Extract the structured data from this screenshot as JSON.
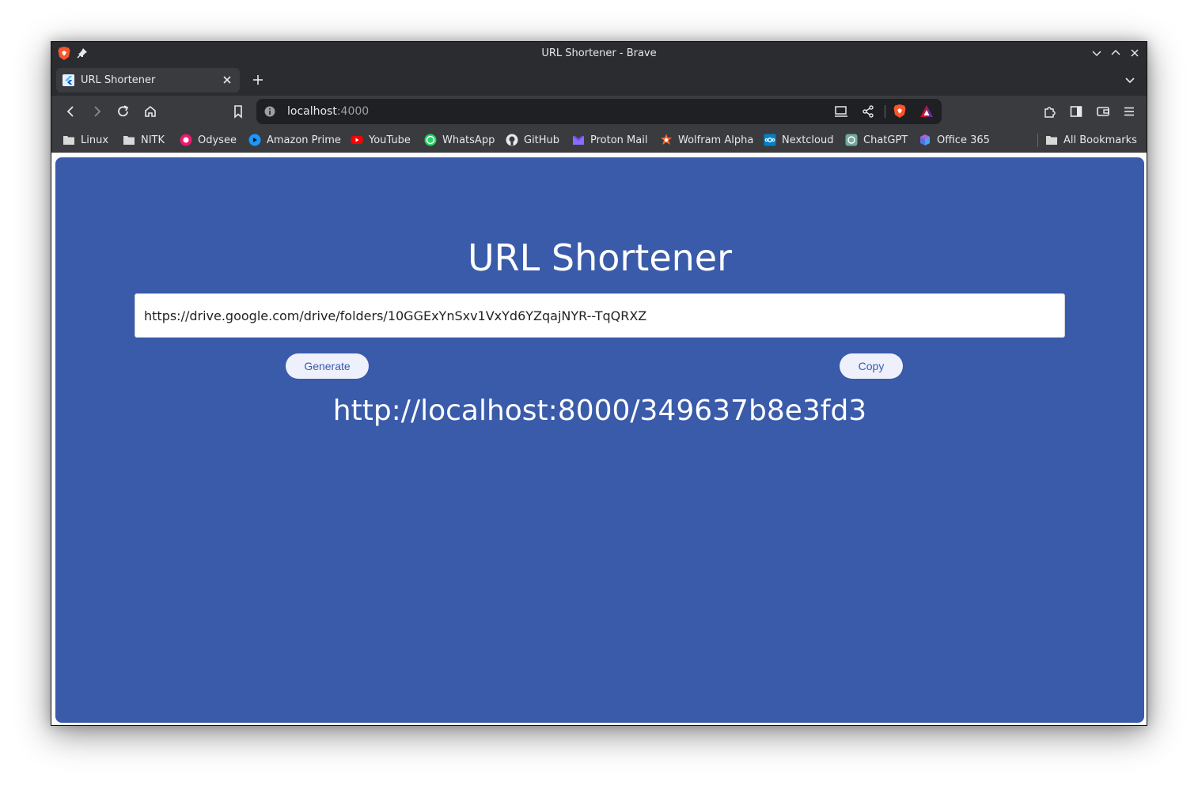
{
  "window": {
    "title": "URL Shortener - Brave"
  },
  "tab": {
    "label": "URL Shortener"
  },
  "address_bar": {
    "host": "localhost",
    "port": ":4000"
  },
  "bookmarks": [
    {
      "label": "Linux",
      "icon": "folder-icon"
    },
    {
      "label": "NITK",
      "icon": "folder-icon"
    },
    {
      "label": "Odysee",
      "icon": "odysee-icon"
    },
    {
      "label": "Amazon Prime",
      "icon": "prime-video-icon"
    },
    {
      "label": "YouTube",
      "icon": "youtube-icon"
    },
    {
      "label": "WhatsApp",
      "icon": "whatsapp-icon"
    },
    {
      "label": "GitHub",
      "icon": "github-icon"
    },
    {
      "label": "Proton Mail",
      "icon": "proton-mail-icon"
    },
    {
      "label": "Wolfram Alpha",
      "icon": "wolfram-icon"
    },
    {
      "label": "Nextcloud",
      "icon": "nextcloud-icon"
    },
    {
      "label": "ChatGPT",
      "icon": "chatgpt-icon"
    },
    {
      "label": "Office 365",
      "icon": "office-icon"
    }
  ],
  "all_bookmarks": {
    "label": "All Bookmarks"
  },
  "app": {
    "title": "URL Shortener",
    "input_value": "https://drive.google.com/drive/folders/10GGExYnSxv1VxYd6YZqajNYR--TqQRXZ",
    "generate_label": "Generate",
    "copy_label": "Copy",
    "short_url": "http://localhost:8000/349637b8e3fd3"
  },
  "colors": {
    "app_background": "#3a5ba9",
    "button_background": "#eef0fb",
    "chrome_dark": "#2b2c2f",
    "toolbar": "#3a3b3f"
  }
}
